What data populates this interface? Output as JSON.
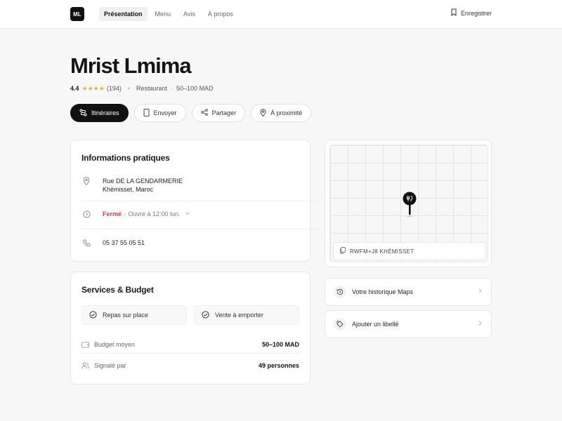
{
  "header": {
    "logo": "ML",
    "nav": [
      "Présentation",
      "Menu",
      "Avis",
      "À propos"
    ],
    "save_label": "Enregistrer"
  },
  "place": {
    "name": "Mrist Lmima",
    "rating": "4.4",
    "rating_value": 4.4,
    "review_count": "(194)",
    "category": "Restaurant",
    "price": "50–100 MAD"
  },
  "actions": {
    "directions": "Itinéraires",
    "send": "Envoyer",
    "share": "Partager",
    "nearby": "À proximité"
  },
  "info": {
    "title": "Informations pratiques",
    "address_line1": "Rue DE LA GENDARMERIE",
    "address_line2": "Khémisset, Maroc",
    "status": "Fermé",
    "hours": "· Ouvre à 12:00 lun.",
    "phone": "05 37 55 05 51"
  },
  "services": {
    "title": "Services & Budget",
    "options": [
      "Repas sur place",
      "Vente à emporter"
    ],
    "budget_label": "Budget moyen",
    "budget_value": "50–100 MAD",
    "reported_label": "Signalé par",
    "reported_value": "49 personnes"
  },
  "map": {
    "plus_code": "RWFM+J8 KHÉMISSET"
  },
  "links": {
    "history": "Votre historique Maps",
    "label": "Ajouter un libellé"
  },
  "colors": {
    "accent": "#111111",
    "star": "#f2b01e",
    "closed": "#d63b3b"
  }
}
